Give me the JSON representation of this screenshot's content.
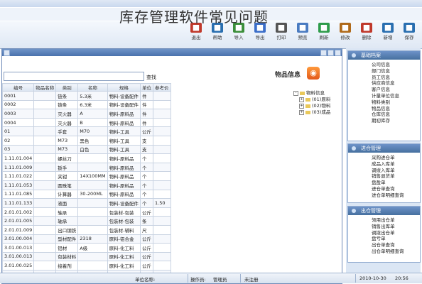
{
  "page_title": "库存管理软件常见问题",
  "toolbar": [
    {
      "label": "退出",
      "icon": "exit-icon",
      "color": "#c0392b"
    },
    {
      "label": "帮助",
      "icon": "help-icon",
      "color": "#2a6fb0"
    },
    {
      "label": "导入",
      "icon": "import-icon",
      "color": "#3b8e3b"
    },
    {
      "label": "导出",
      "icon": "export-icon",
      "color": "#3b6ec9"
    },
    {
      "label": "打印",
      "icon": "print-icon",
      "color": "#555555"
    },
    {
      "label": "预览",
      "icon": "preview-icon",
      "color": "#4a7bc1"
    },
    {
      "label": "刷新",
      "icon": "refresh-icon",
      "color": "#2e9c4a"
    },
    {
      "label": "修改",
      "icon": "edit-icon",
      "color": "#b06a1a"
    },
    {
      "label": "删除",
      "icon": "delete-icon",
      "color": "#c0392b"
    },
    {
      "label": "新增",
      "icon": "new-icon",
      "color": "#2a6fb0"
    },
    {
      "label": "保存",
      "icon": "save-icon",
      "color": "#2a6fb0"
    }
  ],
  "window": {
    "title": "物品信息"
  },
  "search": {
    "label": "查找"
  },
  "panel": {
    "title": "物品信息"
  },
  "table": {
    "headers": [
      "编号",
      "物品名称",
      "类别",
      "名称",
      "规格",
      "数量单位",
      "单位",
      "参考价"
    ],
    "rows": [
      [
        "0001",
        "",
        "链条",
        "5.3米",
        "物料-设备配件",
        "件",
        ""
      ],
      [
        "0002",
        "",
        "链条",
        "6.3米",
        "物料-设备配件",
        "件",
        ""
      ],
      [
        "0003",
        "",
        "灭火器",
        "A",
        "物料-原料品",
        "件",
        ""
      ],
      [
        "0004",
        "",
        "灭火器",
        "B",
        "物料-原料品",
        "件",
        ""
      ],
      [
        "01",
        "",
        "手套",
        "M70",
        "物料-工具",
        "公斤",
        ""
      ],
      [
        "02",
        "",
        "M73",
        "黑色",
        "物料-工具",
        "支",
        ""
      ],
      [
        "03",
        "",
        "M73",
        "白色",
        "物料-工具",
        "支",
        ""
      ],
      [
        "1.11.01.004",
        "",
        "螺丝刀",
        "",
        "物料-原料品",
        "个",
        ""
      ],
      [
        "1.11.01.009",
        "",
        "扳手",
        "",
        "物料-原料品",
        "个",
        ""
      ],
      [
        "1.11.01.022",
        "",
        "夹钳",
        "14X100MM",
        "物料-原料品",
        "个",
        ""
      ],
      [
        "1.11.01.053",
        "",
        "圆珠笔",
        "",
        "物料-原料品",
        "个",
        ""
      ],
      [
        "1.11.01.085",
        "",
        "计算器",
        "30-200ML",
        "物料-原料品",
        "个",
        ""
      ],
      [
        "1.11.01.133",
        "",
        "液面",
        "",
        "物料-设备配件",
        "个",
        "1.50"
      ],
      [
        "2.01.01.002",
        "",
        "轴承",
        "",
        "包装材-包装",
        "公斤",
        ""
      ],
      [
        "2.01.01.005",
        "",
        "轴承",
        "",
        "包装材-包装",
        "条",
        ""
      ],
      [
        "2.01.01.009",
        "",
        "出口钢铁",
        "",
        "包装材-辅料",
        "尺",
        ""
      ],
      [
        "3.01.00.004",
        "",
        "型材配件",
        "2318",
        "原料-铝合金",
        "公斤",
        ""
      ],
      [
        "3.01.00.013",
        "",
        "铝材",
        "A级",
        "原料-化工料",
        "公斤",
        ""
      ],
      [
        "3.01.00.013",
        "",
        "包装材料",
        "",
        "原料-化工料",
        "公斤",
        ""
      ],
      [
        "3.01.00.025",
        "",
        "接着剂",
        "",
        "原料-化工料",
        "公斤",
        ""
      ],
      [
        "3.01.00.089",
        "",
        "二氯化碳",
        "",
        "原料-化工料",
        "公斤",
        ""
      ]
    ]
  },
  "tree": [
    {
      "label": "物料信息",
      "level": 0
    },
    {
      "label": "(01)原料",
      "level": 1
    },
    {
      "label": "(02)物料",
      "level": 1
    },
    {
      "label": "(03)成品",
      "level": 1
    }
  ],
  "nav": {
    "basic": {
      "title": "基础档案",
      "items": [
        "公司信息",
        "部门信息",
        "员工信息",
        "供应商信息",
        "客户信息",
        "计量单位信息",
        "物料类别",
        "物品信息",
        "仓库信息",
        "期初库存"
      ]
    },
    "inbound": {
      "title": "进仓管理",
      "items": [
        "采购进仓单",
        "成品入库单",
        "调拨入库单",
        "销售退货单",
        "盘盈单",
        "进仓单查询",
        "进仓单明细查询"
      ]
    },
    "outbound": {
      "title": "出仓管理",
      "items": [
        "领用出仓单",
        "销售出库单",
        "调拨出仓单",
        "盘亏单",
        "出仓单查询",
        "出仓单明细查询"
      ]
    }
  },
  "status": {
    "user_label": "操作员:",
    "user": "管理员",
    "state": "未注册",
    "unit": "单位名称:",
    "date": "2010-10-30",
    "time": "20:56"
  }
}
